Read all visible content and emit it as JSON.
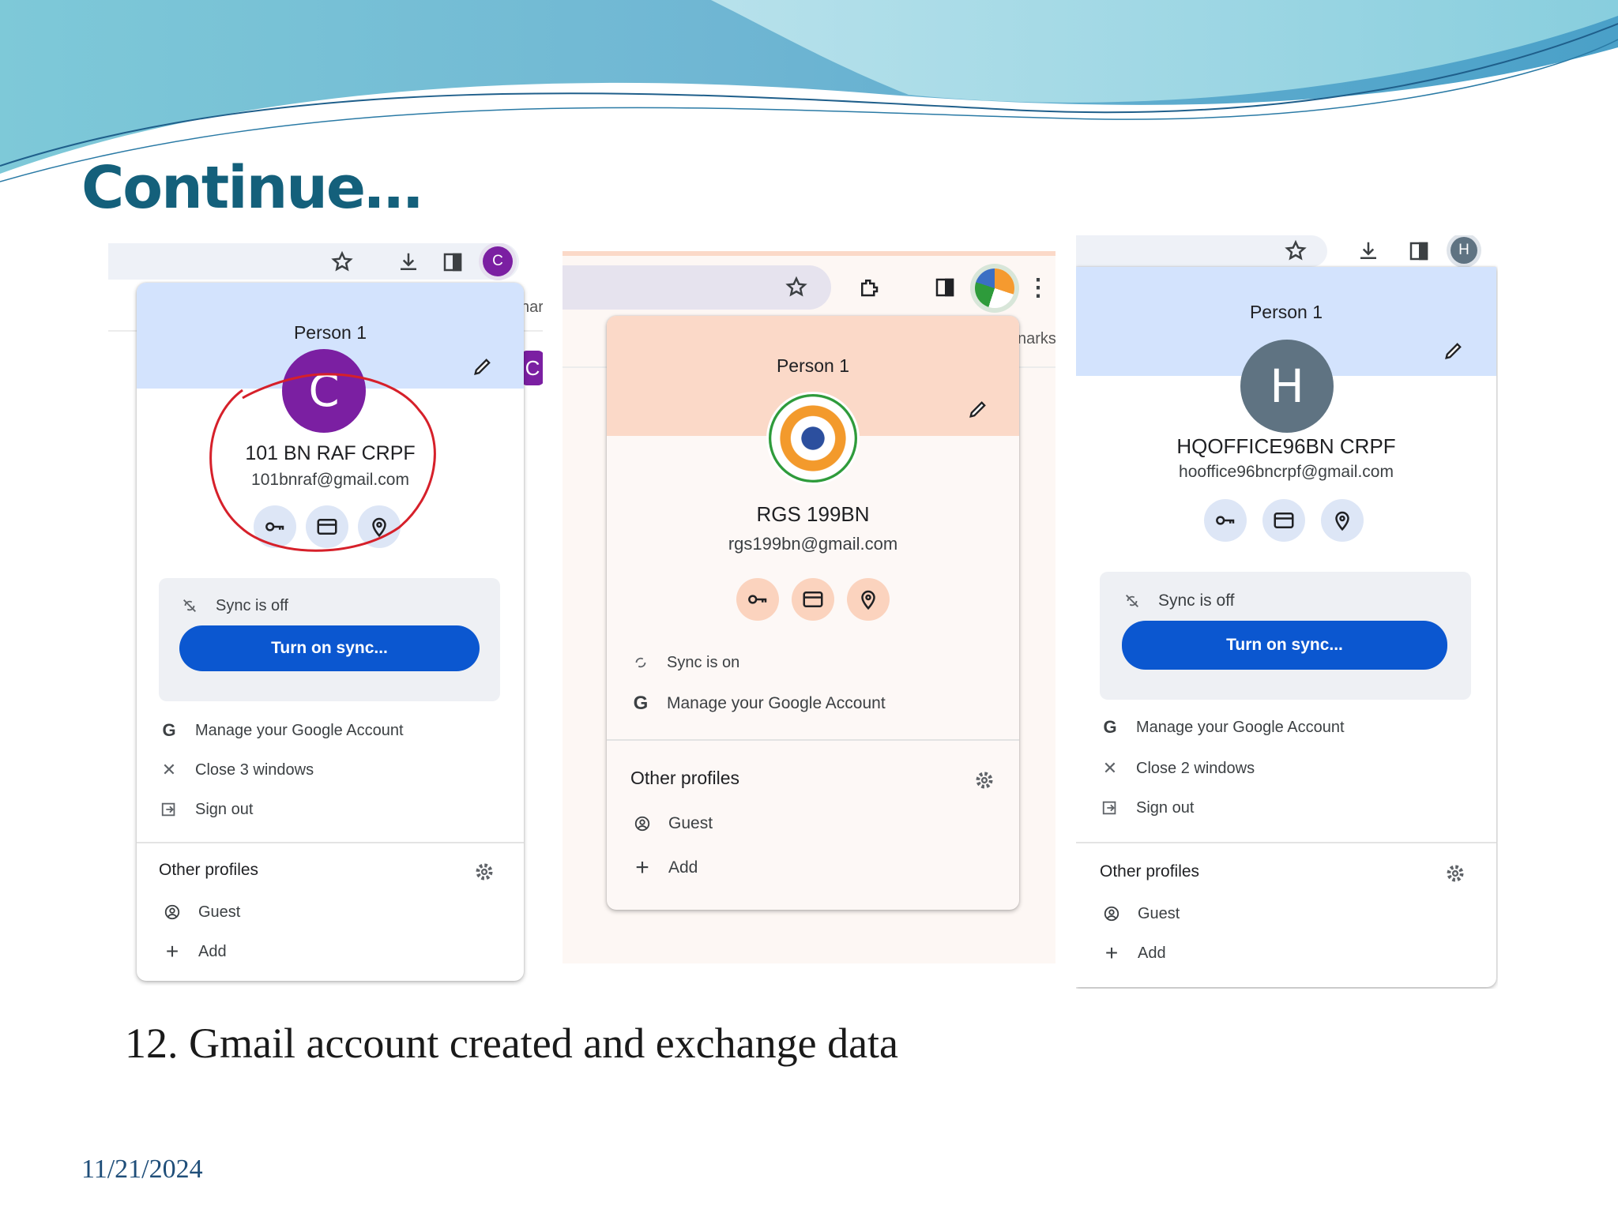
{
  "slide": {
    "title": "Continue…",
    "caption": "12.  Gmail account created and exchange data",
    "date": "11/21/2024"
  },
  "colors": {
    "title": "#14607b",
    "sync_button": "#0b57d0",
    "annotation": "#d6202a",
    "purple_avatar": "#7b1fa2",
    "grey_avatar": "#5f7382",
    "blue_header": "#d3e3fd",
    "peach_header": "#fbd9c8"
  },
  "screens": [
    {
      "profile_label": "Person 1",
      "toolbar_avatar": "C",
      "avatar_letter": "C",
      "name": "101 BN RAF CRPF",
      "email": "101bnraf@gmail.com",
      "quick_icons": [
        "key-icon",
        "card-icon",
        "location-icon"
      ],
      "sync_status": "Sync is off",
      "sync_button": "Turn on sync...",
      "menu": [
        "Manage your Google Account",
        "Close 3 windows",
        "Sign out"
      ],
      "other_profiles_label": "Other profiles",
      "guest_label": "Guest",
      "add_label": "Add",
      "peek_text": "nar",
      "peek_avatar": "C"
    },
    {
      "profile_label": "Person 1",
      "name": "RGS 199BN",
      "email": "rgs199bn@gmail.com",
      "quick_icons": [
        "key-icon",
        "card-icon",
        "location-icon"
      ],
      "sync_status": "Sync is on",
      "menu": [
        "Manage your Google Account"
      ],
      "other_profiles_label": "Other profiles",
      "guest_label": "Guest",
      "add_label": "Add",
      "peek_text": "narks"
    },
    {
      "profile_label": "Person 1",
      "toolbar_avatar": "H",
      "avatar_letter": "H",
      "name": "HQOFFICE96BN CRPF",
      "email": "hoofficе96bncrpf@gmail.com",
      "quick_icons": [
        "key-icon",
        "card-icon",
        "location-icon"
      ],
      "sync_status": "Sync is off",
      "sync_button": "Turn on sync...",
      "menu": [
        "Manage your Google Account",
        "Close 2 windows",
        "Sign out"
      ],
      "other_profiles_label": "Other profiles",
      "guest_label": "Guest",
      "add_label": "Add"
    }
  ]
}
